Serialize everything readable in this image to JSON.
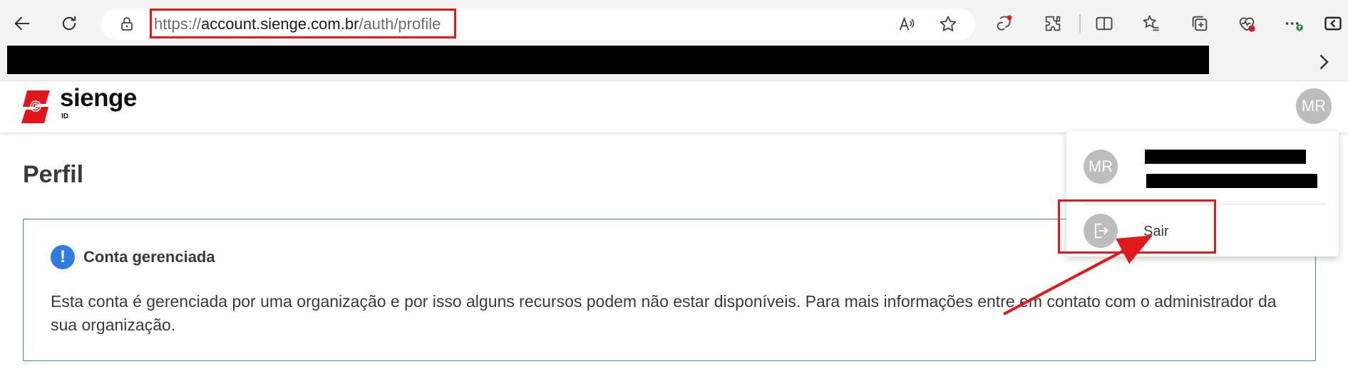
{
  "browser": {
    "url_host_prefix": "https://",
    "url_host": "account.sienge.com.br",
    "url_path": "/auth/profile"
  },
  "app": {
    "brand_name": "sienge",
    "brand_sub": "ID",
    "user_initials": "MR"
  },
  "page": {
    "title": "Perfil"
  },
  "notice": {
    "icon": "!",
    "title": "Conta gerenciada",
    "body": "Esta conta é gerenciada por uma organização e por isso alguns recursos podem não estar disponíveis. Para mais informações entre em contato com o administrador da sua organização."
  },
  "account_menu": {
    "initials": "MR",
    "logout_label": "Sair"
  },
  "colors": {
    "brand_red": "#e3151a",
    "info_blue": "#2f7be0",
    "annotation_red": "#e11919"
  },
  "icons": [
    "back-icon",
    "refresh-icon",
    "lock-icon",
    "read-aloud-icon",
    "favorite-star-icon",
    "copilot-icon",
    "extensions-icon",
    "split-screen-icon",
    "favorites-icon",
    "collections-icon",
    "browser-essentials-icon",
    "more-icon",
    "sidebar-icon",
    "chevron-right-icon",
    "logout-icon"
  ]
}
